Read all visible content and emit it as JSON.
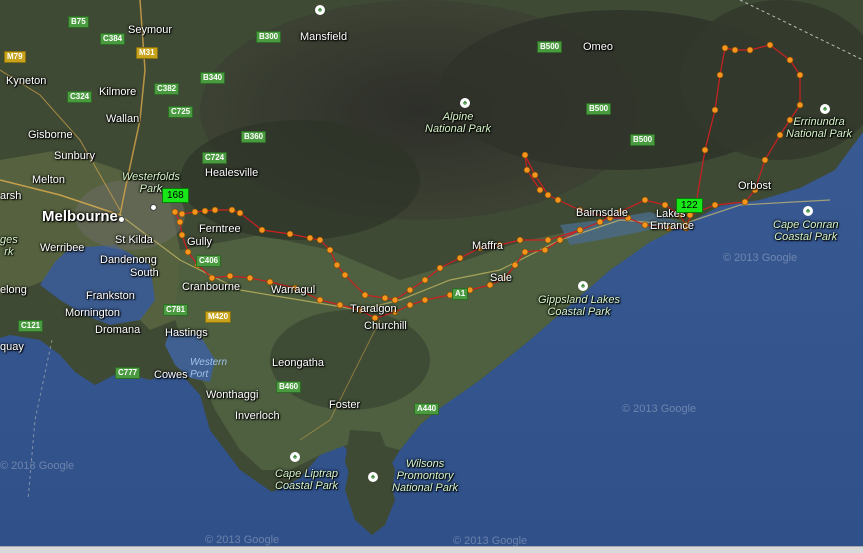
{
  "map": {
    "towns": [
      {
        "name": "Seymour"
      },
      {
        "name": "Mansfield"
      },
      {
        "name": "Omeo"
      },
      {
        "name": "Kyneton"
      },
      {
        "name": "Kilmore"
      },
      {
        "name": "Wallan"
      },
      {
        "name": "Gisborne"
      },
      {
        "name": "Sunbury"
      },
      {
        "name": "Melton"
      },
      {
        "name": "Healesville"
      },
      {
        "name": "Melbourne"
      },
      {
        "name": "Ferntree"
      },
      {
        "name": "Gully"
      },
      {
        "name": "St Kilda"
      },
      {
        "name": "Werribee"
      },
      {
        "name": "Dandenong"
      },
      {
        "name": "South"
      },
      {
        "name": "Cranbourne"
      },
      {
        "name": "Frankston"
      },
      {
        "name": "Mornington"
      },
      {
        "name": "Dromana"
      },
      {
        "name": "Hastings"
      },
      {
        "name": "Cowes"
      },
      {
        "name": "Warragul"
      },
      {
        "name": "Traralgon"
      },
      {
        "name": "Churchill"
      },
      {
        "name": "Maffra"
      },
      {
        "name": "Sale"
      },
      {
        "name": "Bairnsdale"
      },
      {
        "name": "Lakes"
      },
      {
        "name": "Entrance"
      },
      {
        "name": "Orbost"
      },
      {
        "name": "Leongatha"
      },
      {
        "name": "Wonthaggi"
      },
      {
        "name": "Inverloch"
      },
      {
        "name": "Foster"
      },
      {
        "name": "elong"
      },
      {
        "name": "quay"
      },
      {
        "name": "arsh"
      }
    ],
    "parks": [
      {
        "line1": "Alpine",
        "line2": "National Park"
      },
      {
        "line1": "Errinundra",
        "line2": "National Park"
      },
      {
        "line1": "Cape Conran",
        "line2": "Coastal Park"
      },
      {
        "line1": "Gippsland Lakes",
        "line2": "Coastal Park"
      },
      {
        "line1": "Cape Liptrap",
        "line2": "Coastal Park"
      },
      {
        "line1": "Wilsons",
        "line2": "Promontory",
        "line3": "National Park"
      },
      {
        "line1": "Westerfolds",
        "line2": "Park"
      },
      {
        "line1": "ges",
        "line2": "rk"
      }
    ],
    "water": [
      {
        "line1": "Western",
        "line2": "Port"
      }
    ],
    "roads": [
      "B75",
      "C384",
      "M79",
      "M31",
      "C382",
      "C324",
      "B300",
      "B340",
      "C725",
      "B500",
      "B500",
      "B360",
      "C724",
      "B500",
      "C406",
      "C781",
      "M420",
      "C121",
      "C777",
      "B460",
      "A440",
      "A1"
    ],
    "markers": [
      {
        "label": "168"
      },
      {
        "label": "122"
      }
    ],
    "watermarks": [
      "© 2013 Google",
      "© 2013 Google",
      "© 2013 Google",
      "© 2013 Google",
      "© 2013 Google"
    ],
    "colors": {
      "track": "#cc2020",
      "waypoint": "#f7941d",
      "flag": "#19e619",
      "sea": "#36548a"
    }
  }
}
